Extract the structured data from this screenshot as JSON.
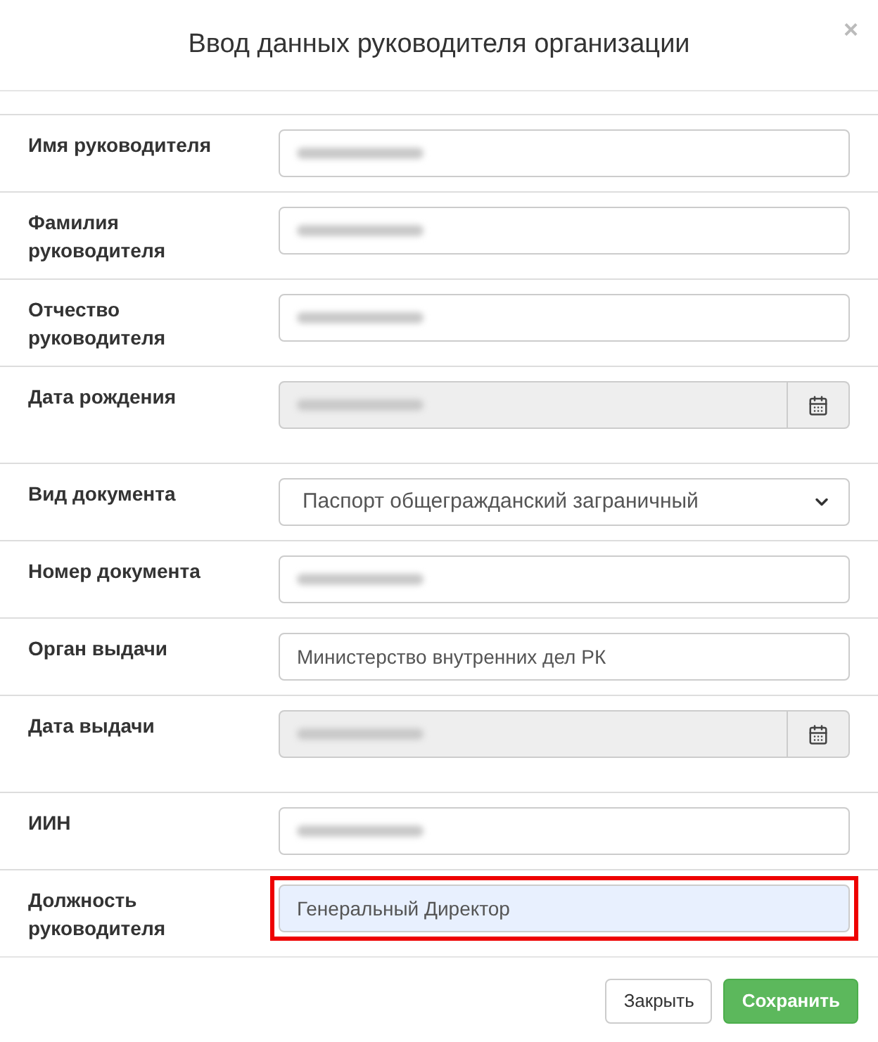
{
  "dialog": {
    "title": "Ввод данных руководителя организации",
    "close": "×"
  },
  "fields": [
    {
      "label": "Имя руководителя",
      "kind": "text",
      "value_hidden": true,
      "disabled": false,
      "highlighted": false
    },
    {
      "label": "Фамилия руководителя",
      "kind": "text",
      "value_hidden": true,
      "disabled": false,
      "highlighted": false
    },
    {
      "label": "Отчество руководителя",
      "kind": "text",
      "value_hidden": true,
      "disabled": false,
      "highlighted": false
    },
    {
      "label": "Дата рождения",
      "kind": "date",
      "value_hidden": true,
      "disabled": true,
      "highlighted": false
    },
    {
      "label": "Вид документа",
      "kind": "select",
      "value": "Паспорт общегражданский заграничный",
      "disabled": false,
      "highlighted": false
    },
    {
      "label": "Номер документа",
      "kind": "text",
      "value_hidden": true,
      "disabled": false,
      "highlighted": false
    },
    {
      "label": "Орган выдачи",
      "kind": "text",
      "value": "Министерство внутренних дел РК",
      "disabled": false,
      "highlighted": false
    },
    {
      "label": "Дата выдачи",
      "kind": "date",
      "value_hidden": true,
      "disabled": true,
      "highlighted": false
    },
    {
      "label": "ИИН",
      "kind": "text",
      "value_hidden": true,
      "disabled": false,
      "highlighted": false
    },
    {
      "label": "Должность руководителя",
      "kind": "text",
      "value": "Генеральный Директор",
      "disabled": false,
      "highlighted": true
    }
  ],
  "buttons": [
    {
      "label": "Закрыть",
      "kind": "default"
    },
    {
      "label": "Сохранить",
      "kind": "primary"
    }
  ]
}
